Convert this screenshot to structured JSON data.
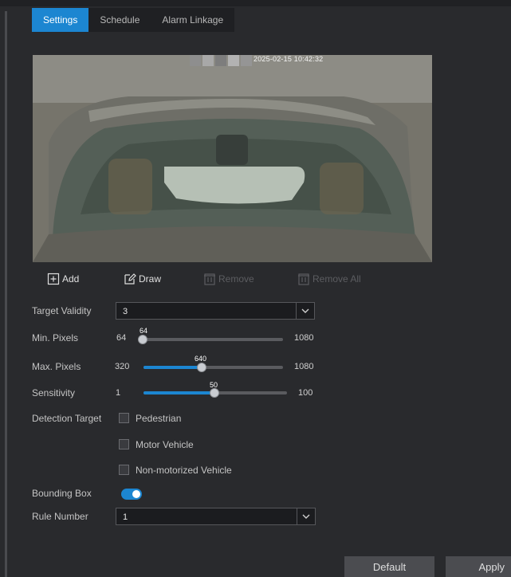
{
  "tabs": [
    {
      "label": "Settings",
      "active": true
    },
    {
      "label": "Schedule",
      "active": false
    },
    {
      "label": "Alarm Linkage",
      "active": false
    }
  ],
  "preview": {
    "timestamp": "2025-02-15 10:42:32"
  },
  "tools": {
    "add": "Add",
    "draw": "Draw",
    "remove": "Remove",
    "remove_all": "Remove All"
  },
  "target_validity": {
    "label": "Target Validity",
    "value": "3"
  },
  "min_pixels": {
    "label": "Min. Pixels",
    "min": "64",
    "max": "1080",
    "value": "64"
  },
  "max_pixels": {
    "label": "Max. Pixels",
    "min": "320",
    "max": "1080",
    "value": "640"
  },
  "sensitivity": {
    "label": "Sensitivity",
    "min": "1",
    "max": "100",
    "value": "50"
  },
  "detection_target": {
    "label": "Detection Target",
    "options": [
      {
        "label": "Pedestrian",
        "checked": false
      },
      {
        "label": "Motor Vehicle",
        "checked": false
      },
      {
        "label": "Non-motorized Vehicle",
        "checked": false
      }
    ]
  },
  "bounding_box": {
    "label": "Bounding Box",
    "enabled": true
  },
  "rule_number": {
    "label": "Rule Number",
    "value": "1"
  },
  "buttons": {
    "default": "Default",
    "apply": "Apply"
  },
  "colors": {
    "accent": "#1c86d1",
    "background": "#292a2d",
    "control": "#1b1c1f"
  }
}
